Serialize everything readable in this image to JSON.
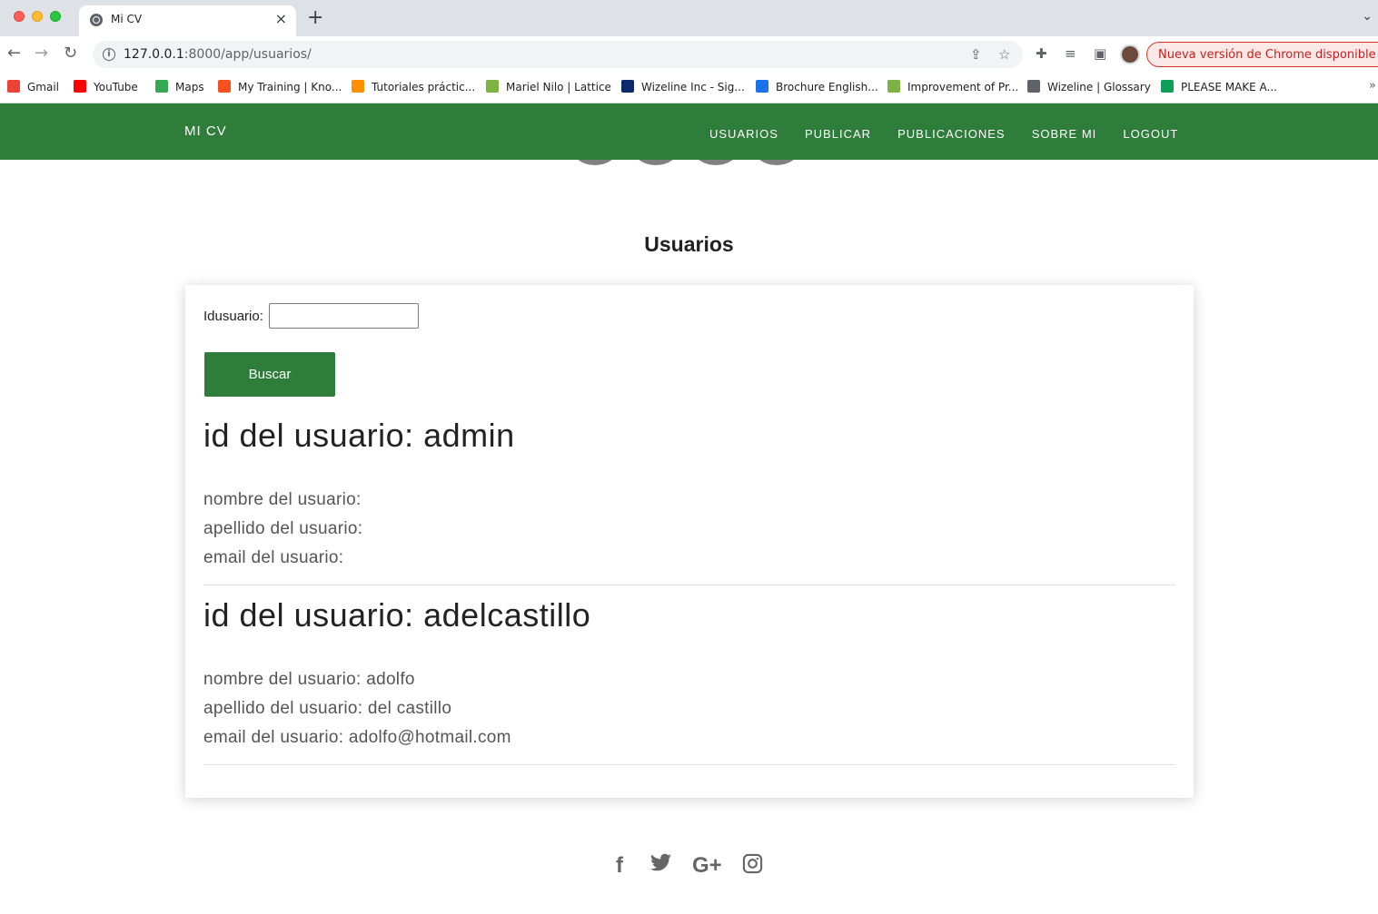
{
  "browser": {
    "tab_title": "Mi CV",
    "url_host": "127.0.0.1",
    "url_rest": ":8000/app/usuarios/",
    "update_label": "Nueva versión de Chrome disponible",
    "bookmarks": [
      {
        "label": "Gmail",
        "color": "#ea4335"
      },
      {
        "label": "YouTube",
        "color": "#ff0000"
      },
      {
        "label": "Maps",
        "color": "#34a853"
      },
      {
        "label": "My Training | Kno...",
        "color": "#f4511e"
      },
      {
        "label": "Tutoriales práctic...",
        "color": "#ff8f00"
      },
      {
        "label": "Mariel Nilo | Lattice",
        "color": "#7cb342"
      },
      {
        "label": "Wizeline Inc - Sig...",
        "color": "#0b2a6b"
      },
      {
        "label": "Brochure English...",
        "color": "#1a73e8"
      },
      {
        "label": "Improvement of Pr...",
        "color": "#7cb342"
      },
      {
        "label": "Wizeline | Glossary",
        "color": "#5f6368"
      },
      {
        "label": "PLEASE MAKE A...",
        "color": "#0f9d58"
      }
    ]
  },
  "site": {
    "brand": "MI CV",
    "nav": [
      "USUARIOS",
      "PUBLICAR",
      "PUBLICACIONES",
      "SOBRE MI",
      "LOGOUT"
    ],
    "accent": "#2e7d3a"
  },
  "page": {
    "title": "Usuarios",
    "field_label": "Idusuario:",
    "field_value": "",
    "button_label": "Buscar"
  },
  "users": [
    {
      "id_line": "id del usuario: admin",
      "name_line": "nombre del usuario:",
      "last_line": "apellido del usuario:",
      "email_line": "email del usuario:"
    },
    {
      "id_line": "id del usuario: adelcastillo",
      "name_line": "nombre del usuario: adolfo",
      "last_line": "apellido del usuario: del castillo",
      "email_line": "email del usuario: adolfo@hotmail.com"
    }
  ],
  "footer": {
    "social_icons": [
      "facebook-icon",
      "twitter-icon",
      "google-plus-icon",
      "instagram-icon"
    ],
    "facebook": "f",
    "googleplus": "G+"
  }
}
